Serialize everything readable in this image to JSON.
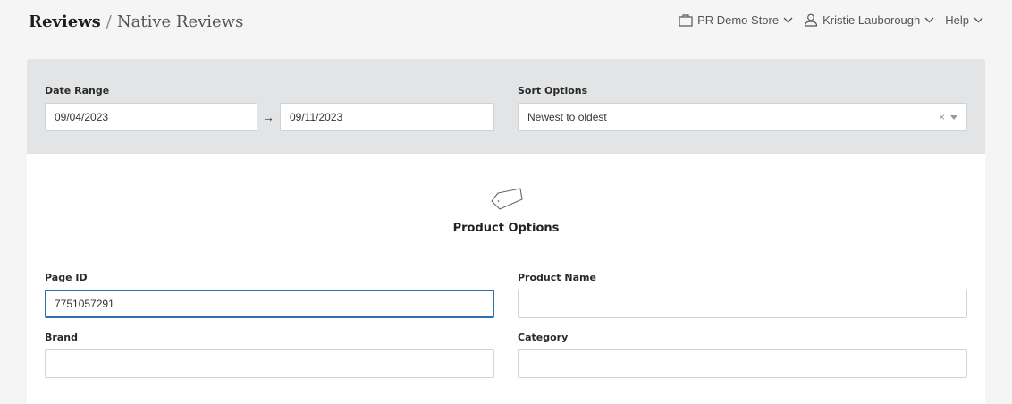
{
  "header": {
    "breadcrumb_root": "Reviews",
    "breadcrumb_sep": "/",
    "breadcrumb_current": "Native Reviews",
    "store": "PR Demo Store",
    "user": "Kristie Lauborough",
    "help": "Help"
  },
  "filters": {
    "date_range_label": "Date Range",
    "date_from": "09/04/2023",
    "date_arrow": "→",
    "date_to": "09/11/2023",
    "sort_label": "Sort Options",
    "sort_value": "Newest to oldest",
    "sort_clear": "×"
  },
  "product_options": {
    "title": "Product Options",
    "page_id_label": "Page ID",
    "page_id_value": "7751057291",
    "product_name_label": "Product Name",
    "product_name_value": "",
    "brand_label": "Brand",
    "brand_value": "",
    "category_label": "Category",
    "category_value": ""
  },
  "icons": {
    "store": "store-icon",
    "user": "user-icon",
    "tag": "tag-icon",
    "chevron": "chevron-down-icon"
  },
  "colors": {
    "focus": "#2e6fb3",
    "panel": "#e3e4e5"
  }
}
